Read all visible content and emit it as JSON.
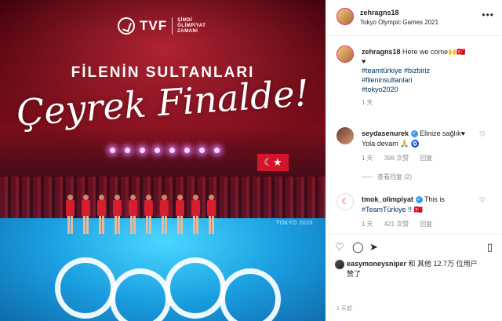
{
  "image": {
    "brand_name": "TVF",
    "brand_sub_line1": "ŞİMDİ",
    "brand_sub_line2": "OLİMPİYAT",
    "brand_sub_line3": "ZAMANI",
    "headline": "FİLENİN SULTANLARI",
    "script_title": "Çeyrek Finalde!",
    "court_tag": "TOKYO 2020"
  },
  "header": {
    "username": "zehragns18",
    "location": "Tokyo Olympic Games 2021",
    "more_icon": "more-horizontal-icon"
  },
  "caption": {
    "username": "zehragns18",
    "text": "Here we come",
    "emoji": "🙌🇹🇷",
    "heart": "♥",
    "hashtags": [
      "#teamtürkiye",
      "#bizbiriz",
      "#fileninsultanlari",
      "#tokyo2020"
    ],
    "time": "1 天"
  },
  "comments": [
    {
      "username": "seydasenurek",
      "text": "Elinize sağlık♥",
      "text2": "Yola devam 🙏 🧿",
      "time": "1 天",
      "likes": "398 次赞",
      "reply": "回复",
      "view_replies": "查看回复 (2)"
    },
    {
      "username": "tmok_olimpiyat",
      "text": "This is",
      "text2": "#TeamTürkiye !! 🇹🇷",
      "time": "1 天",
      "likes": "421 次赞",
      "reply": "回复"
    }
  ],
  "likes": {
    "username": "easymoneysniper",
    "text": " 和 其他 12.7万 位用户",
    "text2": "赞了"
  },
  "timestamp": "1 天前",
  "colors": {
    "link": "#00376b",
    "verified": "#3897f0",
    "muted": "#8e8e8e",
    "turkey_red": "#e30a17"
  }
}
